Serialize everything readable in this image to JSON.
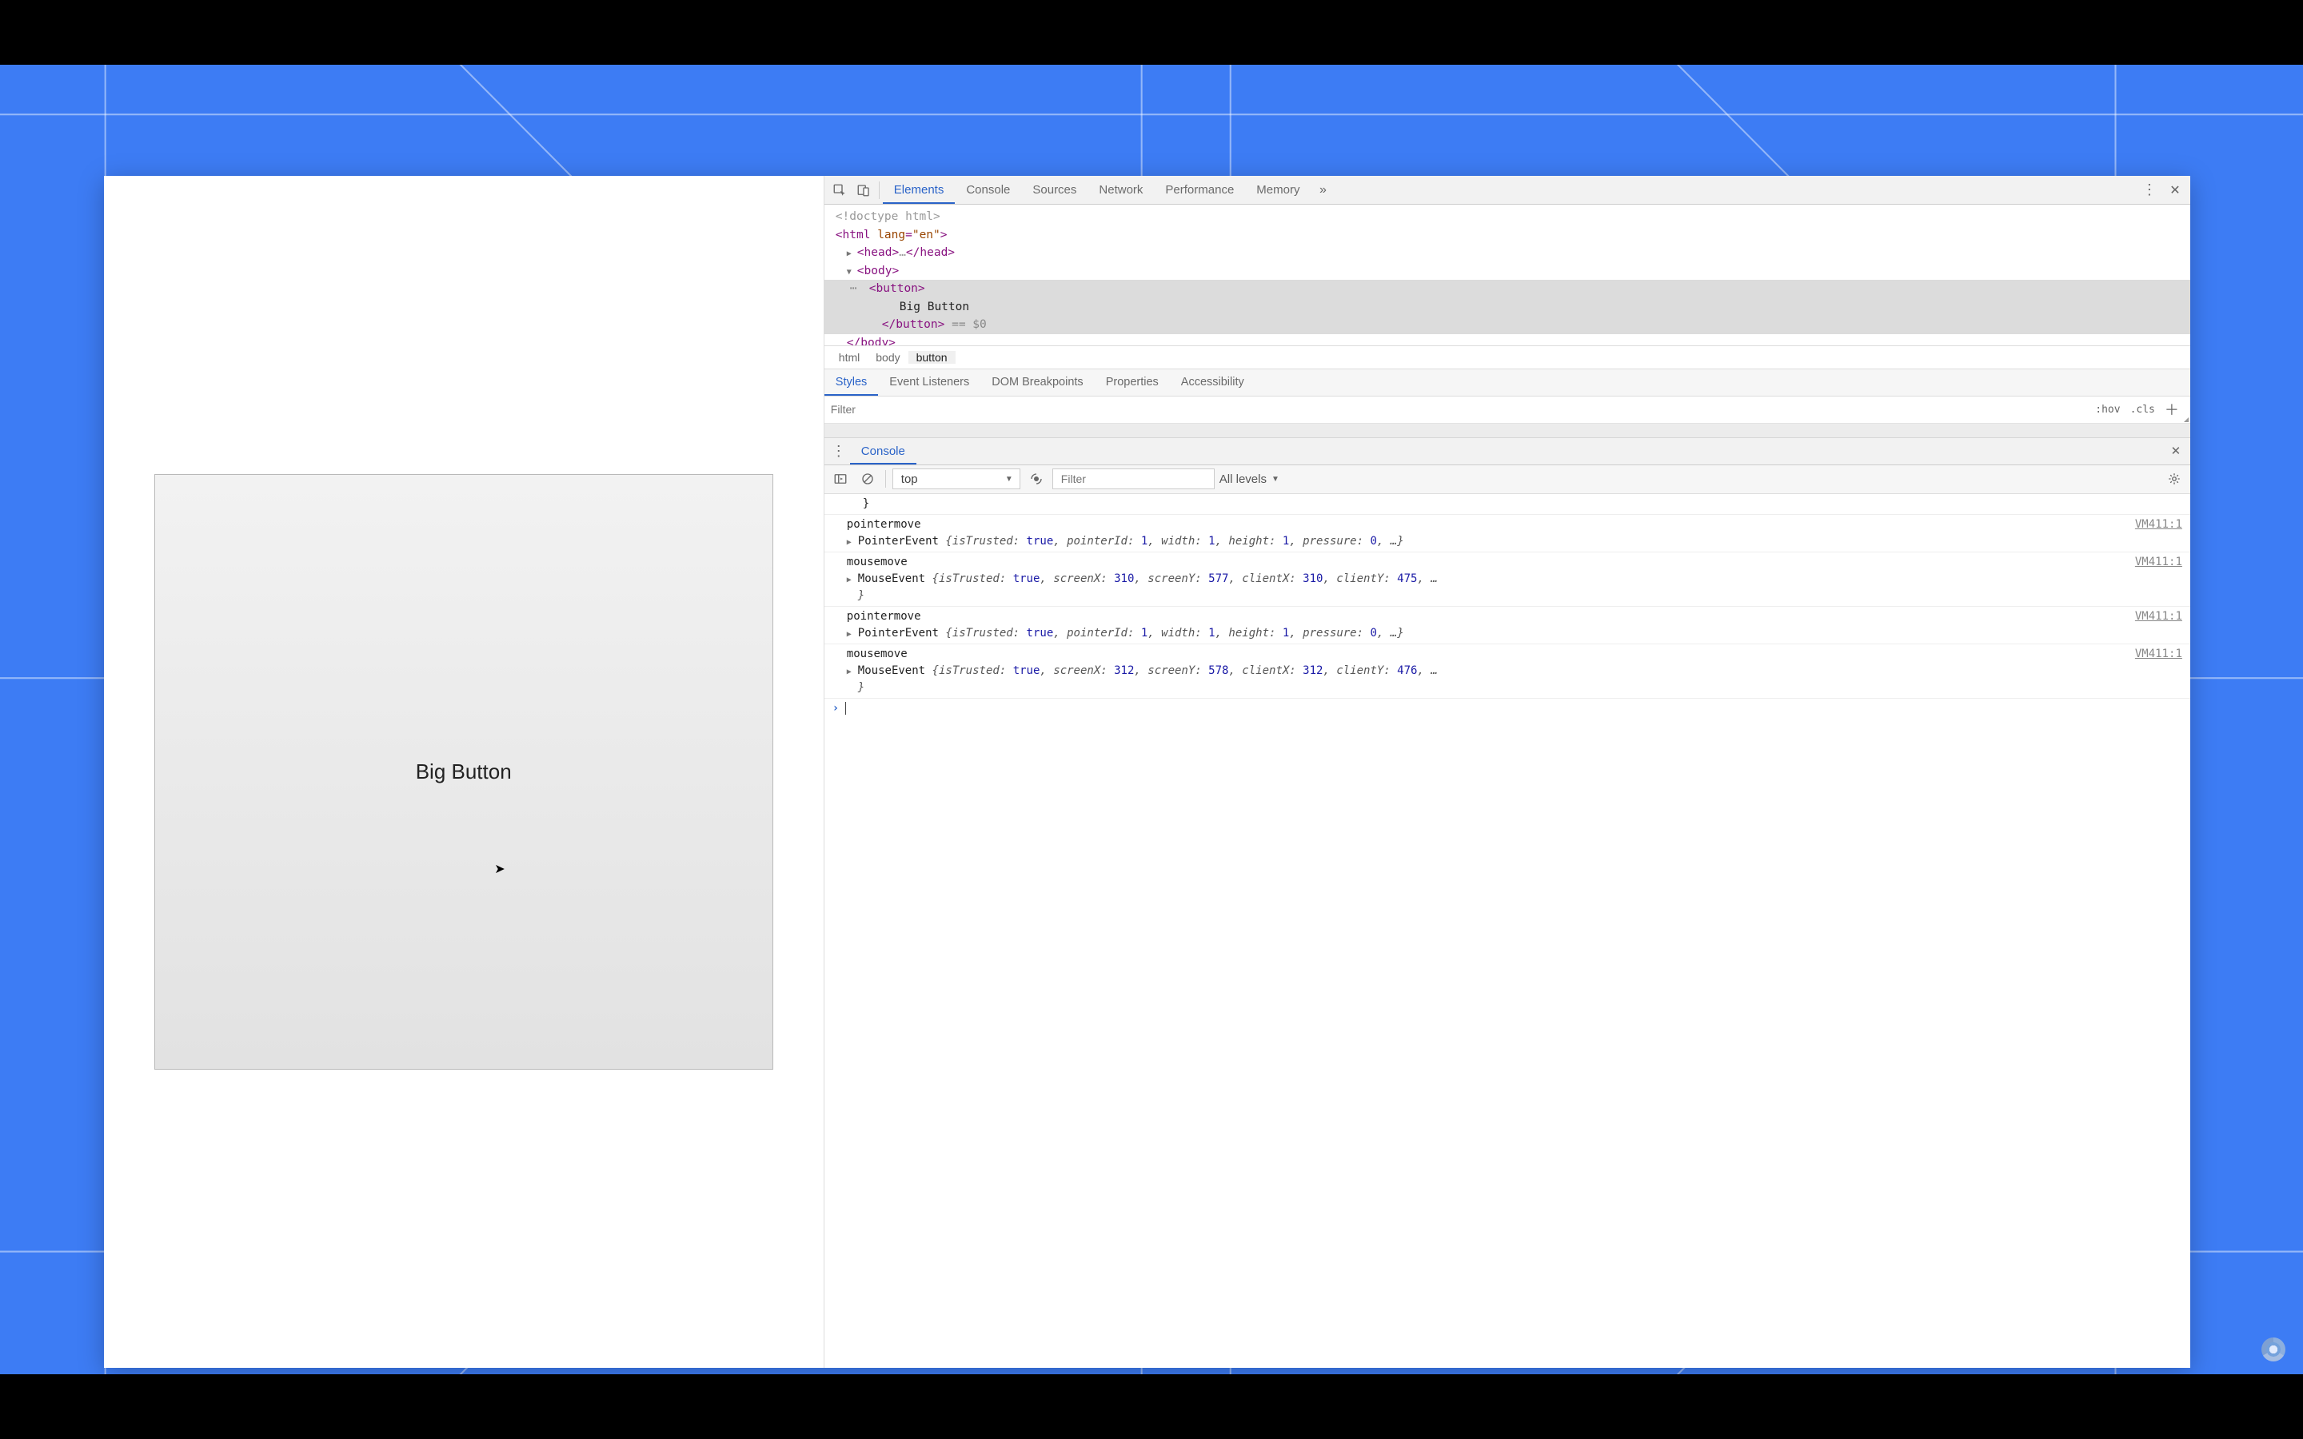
{
  "page": {
    "button_label": "Big Button"
  },
  "devtools": {
    "tabs": [
      "Elements",
      "Console",
      "Sources",
      "Network",
      "Performance",
      "Memory"
    ],
    "active_tab": "Elements",
    "dom": {
      "doctype": "<!doctype html>",
      "html_open": "<html lang=\"en\">",
      "head": "<head>…</head>",
      "body_open": "<body>",
      "button_open": "<button>",
      "button_text": "Big Button",
      "button_close": "</button>",
      "selected_suffix": " == $0",
      "body_close": "</body>"
    },
    "breadcrumb": [
      "html",
      "body",
      "button"
    ],
    "styles_tabs": [
      "Styles",
      "Event Listeners",
      "DOM Breakpoints",
      "Properties",
      "Accessibility"
    ],
    "styles_active": "Styles",
    "filter_placeholder": "Filter",
    "hov_label": ":hov",
    "cls_label": ".cls"
  },
  "console": {
    "tab_label": "Console",
    "context": "top",
    "filter_placeholder": "Filter",
    "levels_label": "All levels",
    "entries": [
      {
        "tail_brace": "}"
      },
      {
        "name": "pointermove",
        "src": "VM411:1",
        "ctor": "PointerEvent",
        "body": "{isTrusted: true, pointerId: 1, width: 1, height: 1, pressure: 0, …}"
      },
      {
        "name": "mousemove",
        "src": "VM411:1",
        "ctor": "MouseEvent",
        "body_open": "{isTrusted: true, screenX: 310, screenY: 577, clientX: 310, clientY: 475, …",
        "tail_brace": "}"
      },
      {
        "name": "pointermove",
        "src": "VM411:1",
        "ctor": "PointerEvent",
        "body": "{isTrusted: true, pointerId: 1, width: 1, height: 1, pressure: 0, …}"
      },
      {
        "name": "mousemove",
        "src": "VM411:1",
        "ctor": "MouseEvent",
        "body_open": "{isTrusted: true, screenX: 312, screenY: 578, clientX: 312, clientY: 476, …",
        "tail_brace": "}"
      }
    ]
  }
}
